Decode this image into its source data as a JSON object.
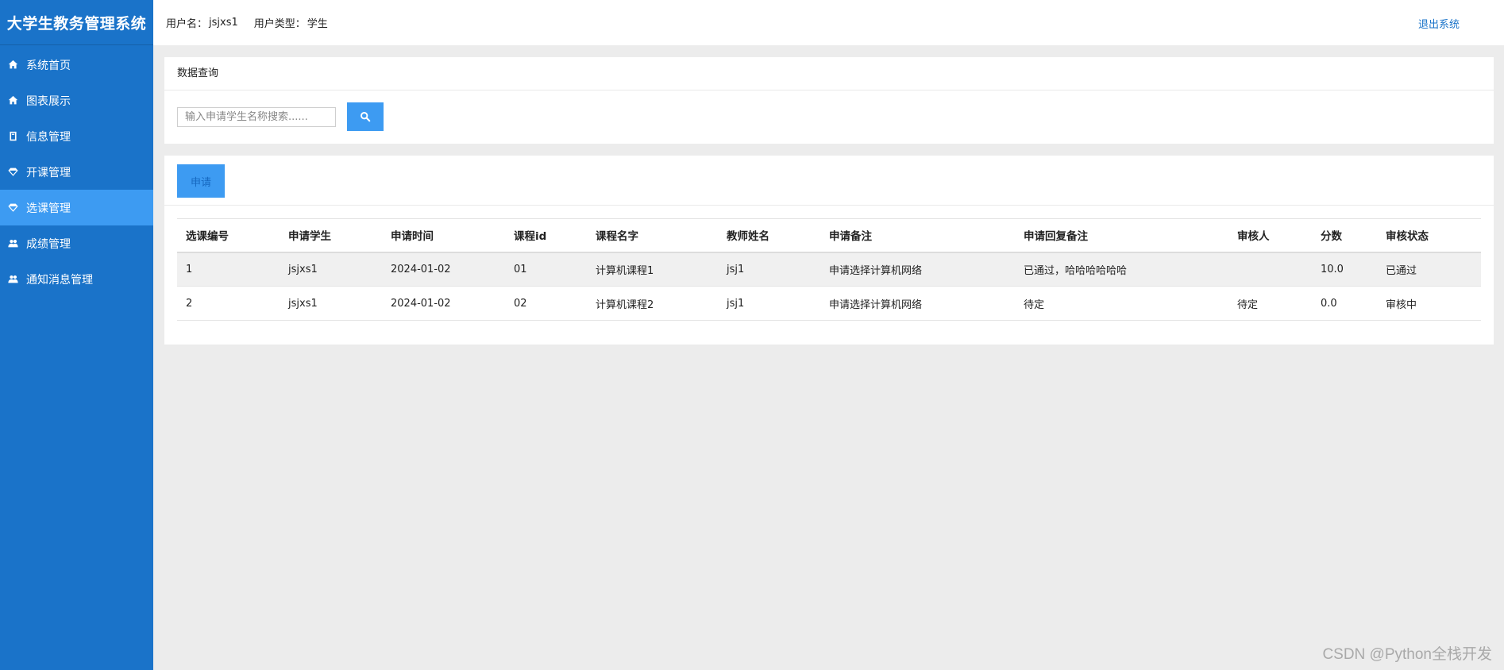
{
  "brand": {
    "title": "大学生教务管理系统"
  },
  "menu": [
    {
      "label": "系统首页",
      "icon": "home-icon",
      "active": false
    },
    {
      "label": "图表展示",
      "icon": "home-icon",
      "active": false
    },
    {
      "label": "信息管理",
      "icon": "book-icon",
      "active": false
    },
    {
      "label": "开课管理",
      "icon": "diamond-icon",
      "active": false
    },
    {
      "label": "选课管理",
      "icon": "diamond-icon",
      "active": true
    },
    {
      "label": "成绩管理",
      "icon": "users-icon",
      "active": false
    },
    {
      "label": "通知消息管理",
      "icon": "users-icon",
      "active": false
    }
  ],
  "header": {
    "username_label": "用户名：",
    "username": "jsjxs1",
    "usertype_label": "用户类型：",
    "usertype": "学生",
    "logout_label": "退出系统"
  },
  "query": {
    "title": "数据查询",
    "search_placeholder": "输入申请学生名称搜索......",
    "search_value": "",
    "search_icon": "search-icon"
  },
  "actions": {
    "apply_label": "申请"
  },
  "table": {
    "columns": [
      "选课编号",
      "申请学生",
      "申请时间",
      "课程id",
      "课程名字",
      "教师姓名",
      "申请备注",
      "申请回复备注",
      "审核人",
      "分数",
      "审核状态"
    ],
    "rows": [
      [
        "1",
        "jsjxs1",
        "2024-01-02",
        "01",
        "计算机课程1",
        "jsj1",
        "申请选择计算机网络",
        "已通过，哈哈哈哈哈哈",
        "",
        "10.0",
        "已通过"
      ],
      [
        "2",
        "jsjxs1",
        "2024-01-02",
        "02",
        "计算机课程2",
        "jsj1",
        "申请选择计算机网络",
        "待定",
        "待定",
        "0.0",
        "审核中"
      ]
    ]
  },
  "watermark": "CSDN @Python全栈开发",
  "colors": {
    "sidebar": "#1a73c9",
    "accent": "#3d9bf2",
    "link": "#1a73c9",
    "background": "#ececec"
  }
}
